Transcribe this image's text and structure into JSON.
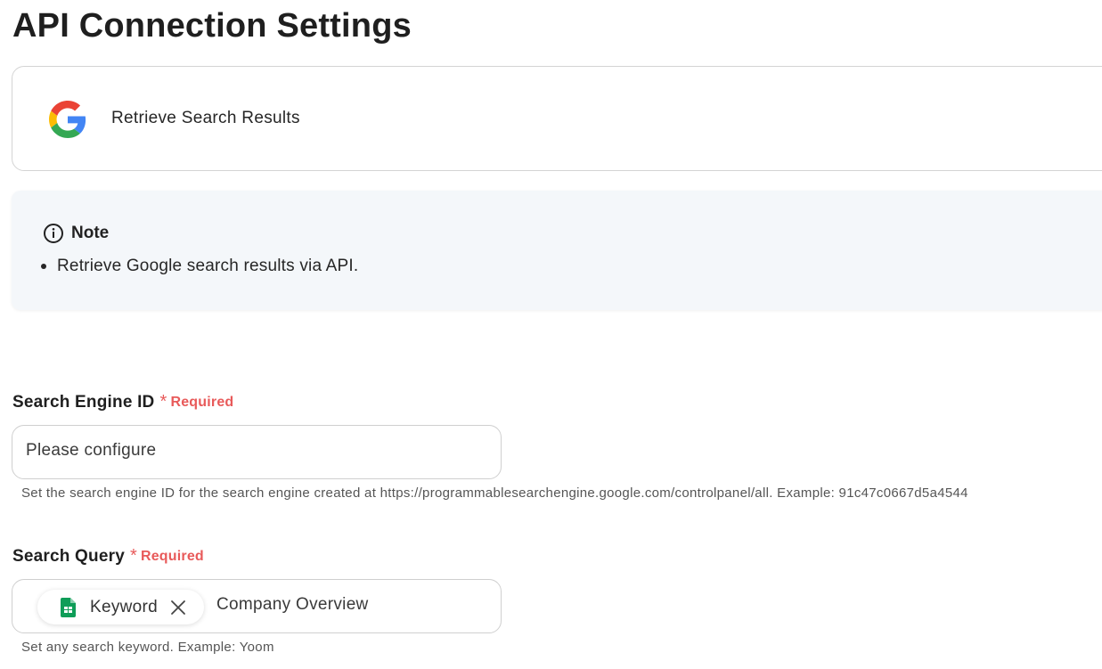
{
  "page": {
    "title": "API Connection Settings"
  },
  "action": {
    "label": "Retrieve Search Results",
    "icon": "google-icon"
  },
  "note": {
    "title": "Note",
    "icon": "info-icon",
    "items": [
      "Retrieve Google search results via API."
    ]
  },
  "fields": {
    "search_engine_id": {
      "label": "Search Engine ID",
      "required_mark": "*",
      "required_text": "Required",
      "value": "Please configure",
      "help": "Set the search engine ID for the search engine created at https://programmablesearchengine.google.com/controlpanel/all. Example: 91c47c0667d5a4544"
    },
    "search_query": {
      "label": "Search Query",
      "required_mark": "*",
      "required_text": "Required",
      "chip_label": "Keyword",
      "chip_icon": "sheets-icon",
      "value": "Company Overview",
      "help": "Set any search keyword. Example: Yoom"
    }
  },
  "colors": {
    "required": "#e85a5a",
    "note_bg": "#f4f7fa",
    "border": "#cfcfcf"
  }
}
